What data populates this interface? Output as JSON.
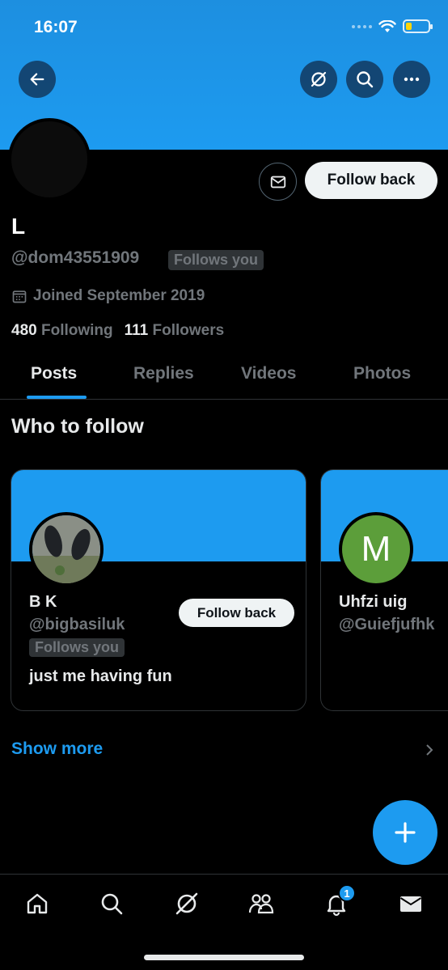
{
  "status_bar": {
    "time": "16:07"
  },
  "header": {
    "back_icon": "arrow-left-icon",
    "grok_icon": "grok-icon",
    "search_icon": "search-icon",
    "more_icon": "more-icon"
  },
  "profile": {
    "name": "L",
    "handle": "@dom43551909",
    "follows_you": "Follows you",
    "joined": "Joined September 2019",
    "following_count": "480",
    "following_label": "Following",
    "followers_count": "111",
    "followers_label": "Followers",
    "follow_button": "Follow back"
  },
  "tabs": [
    {
      "label": "Posts",
      "active": true
    },
    {
      "label": "Replies",
      "active": false
    },
    {
      "label": "Videos",
      "active": false
    },
    {
      "label": "Photos",
      "active": false
    }
  ],
  "who_to_follow": {
    "title": "Who to follow",
    "cards": [
      {
        "name": "B K",
        "handle": "@bigbasiluk",
        "follows_you": "Follows you",
        "bio": "just me having fun",
        "button": "Follow back"
      },
      {
        "name": "Uhfzi uig",
        "handle": "@Guiefjufhk",
        "avatar_letter": "M"
      }
    ],
    "show_more": "Show more"
  },
  "bottom_nav": {
    "items": [
      "home-icon",
      "search-icon",
      "grok-icon",
      "communities-icon",
      "notifications-icon",
      "messages-icon"
    ],
    "notification_count": "1"
  },
  "colors": {
    "accent": "#1d9bf0",
    "background": "#000000",
    "muted": "#71767b",
    "avatar_green": "#5c9e3a"
  }
}
